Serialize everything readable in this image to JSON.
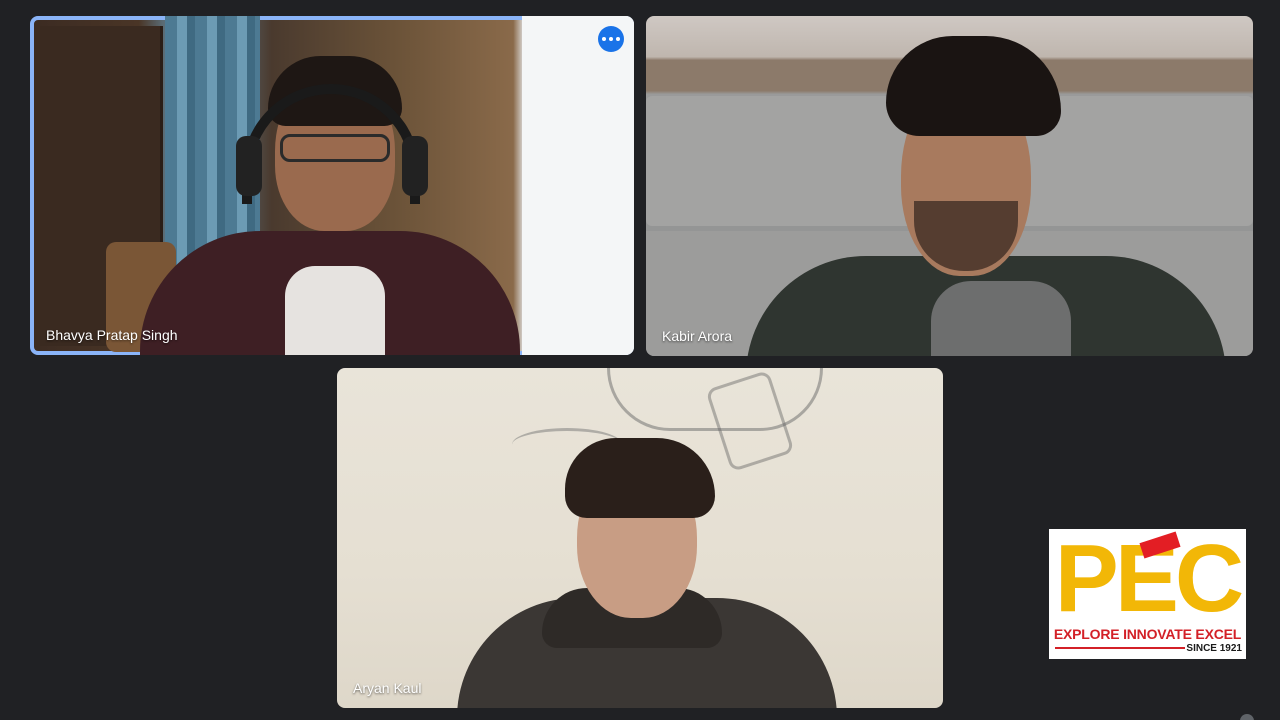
{
  "participants": [
    {
      "name": "Bhavya Pratap Singh",
      "active_speaker": true
    },
    {
      "name": "Kabir Arora",
      "active_speaker": false
    },
    {
      "name": "Aryan Kaul",
      "active_speaker": false
    }
  ],
  "logo": {
    "letters": "PEC",
    "tagline": "EXPLORE INNOVATE EXCEL",
    "since": "SINCE 1921"
  },
  "colors": {
    "background": "#202124",
    "active_outline": "#8ab4f8",
    "more_button": "#1a73e8",
    "logo_yellow": "#f2b707",
    "logo_red": "#d32027"
  },
  "icons": {
    "more_options": "more-horizontal-icon"
  }
}
